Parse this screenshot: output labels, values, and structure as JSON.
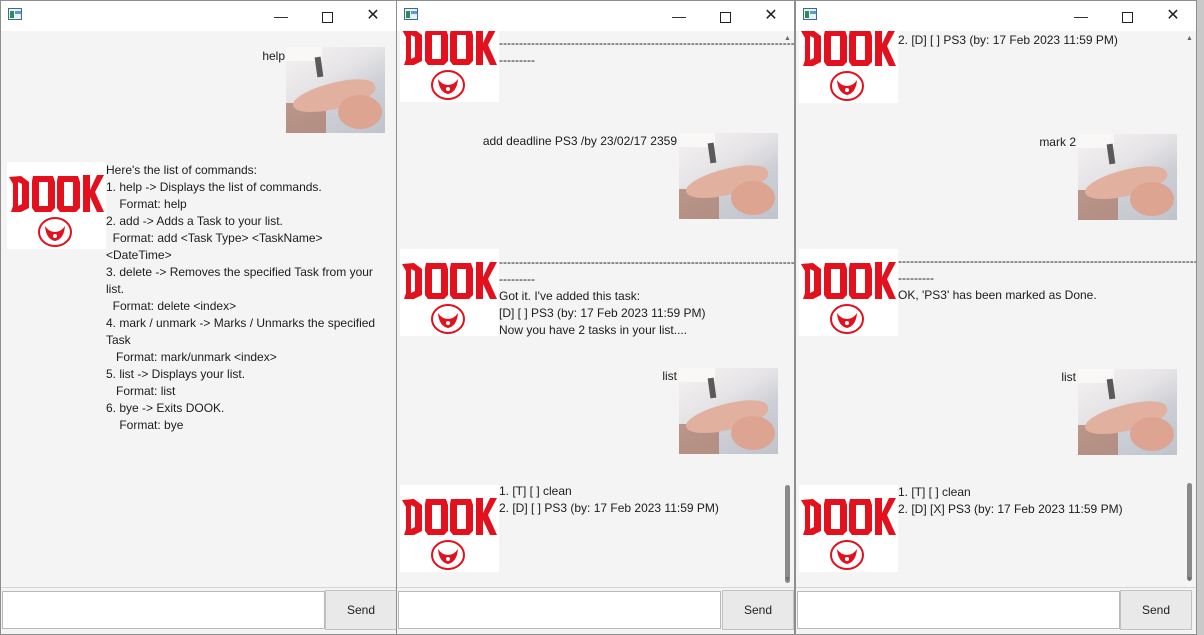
{
  "window_controls": {
    "minimize": "—",
    "close": "✕"
  },
  "send_label": "Send",
  "input_value": "",
  "windows": [
    {
      "user_messages": [
        "help"
      ],
      "bot_messages": [
        "Here's the list of commands:\n1. help -> Displays the list of commands.\n    Format: help\n2. add -> Adds a Task to your list.\n  Format: add <Task Type> <TaskName> <DateTime>\n3. delete -> Removes the specified Task from your list.\n  Format: delete <index>\n4. mark / unmark -> Marks / Unmarks the specified Task\n   Format: mark/unmark <index>\n5. list -> Displays your list.\n   Format: list\n6. bye -> Exits DOOK.\n    Format: bye"
      ]
    },
    {
      "user_messages": [
        "add deadline PS3 /by 23/02/17 2359",
        "list"
      ],
      "bot_messages": [
        "----------------------------------------------------------------------------\n---------",
        "----------------------------------------------------------------------------\n---------\nGot it. I've added this task:\n[D] [ ] PS3 (by: 17 Feb 2023 11:59 PM)\nNow you have 2 tasks in your list....",
        "1. [T] [ ] clean\n2. [D] [ ] PS3 (by: 17 Feb 2023 11:59 PM)"
      ]
    },
    {
      "user_messages": [
        "mark 2",
        "list"
      ],
      "bot_messages": [
        "2. [D] [ ] PS3 (by: 17 Feb 2023 11:59 PM)",
        "----------------------------------------------------------------------------\n---------\nOK, 'PS3' has been marked as Done.",
        "1. [T] [ ] clean\n2. [D] [X] PS3 (by: 17 Feb 2023 11:59 PM)"
      ]
    }
  ],
  "colors": {
    "logo_red": "#e3111d",
    "window_bg": "#f4f4f4",
    "titlebar_bg": "#ffffff"
  },
  "icons": {
    "app": "app-window-icon",
    "user_avatar": "user-photo-avatar",
    "bot_avatar": "dook-logo-avatar"
  }
}
